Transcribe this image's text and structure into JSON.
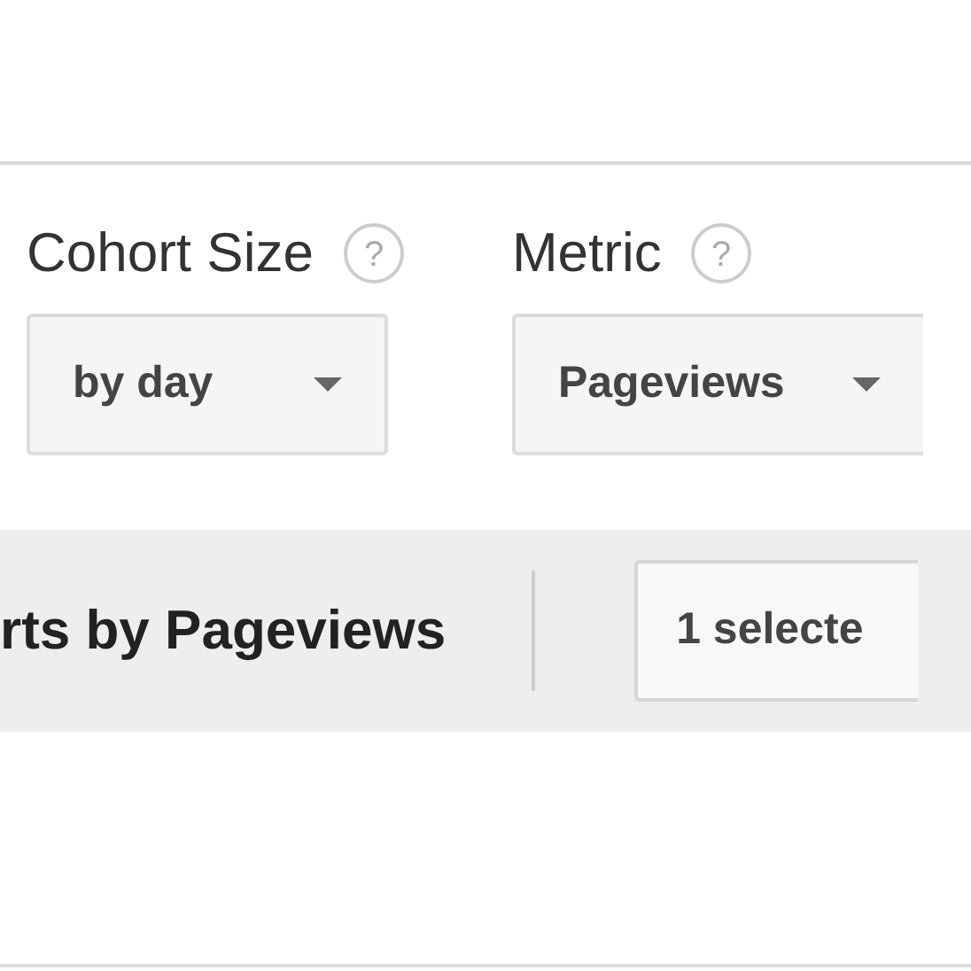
{
  "fields": [
    {
      "label": "Cohort Size",
      "help": "?",
      "value": "by day"
    },
    {
      "label": "Metric",
      "help": "?",
      "value": "Pageviews"
    }
  ],
  "toolbar": {
    "title": "rts by Pageviews",
    "selector": "1 selecte"
  }
}
